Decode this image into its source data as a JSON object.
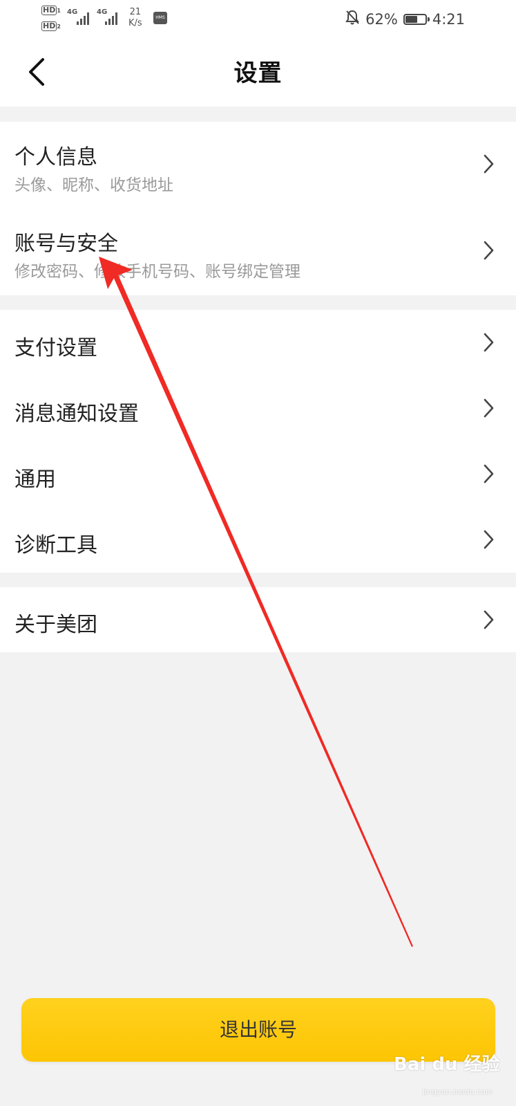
{
  "status_bar": {
    "hd1": "HD",
    "hd1_sub": "1",
    "hd2": "HD",
    "hd2_sub": "2",
    "net1": "4G",
    "net2": "4G",
    "speed_value": "21",
    "speed_unit": "K/s",
    "hms_badge": "HMS",
    "battery_percent": "62%",
    "battery_level": 0.62,
    "time": "4:21",
    "icons": [
      "signal-icon",
      "signal-icon",
      "hms-icon",
      "bell-off-icon",
      "battery-icon"
    ]
  },
  "header": {
    "title": "设置",
    "back_icon": "back-arrow-icon"
  },
  "settings": {
    "account_section": [
      {
        "title": "个人信息",
        "subtitle": "头像、昵称、收货地址"
      },
      {
        "title": "账号与安全",
        "subtitle": "修改密码、修改手机号码、账号绑定管理"
      }
    ],
    "general_section": [
      {
        "title": "支付设置"
      },
      {
        "title": "消息通知设置"
      },
      {
        "title": "通用"
      },
      {
        "title": "诊断工具"
      }
    ],
    "about_section": [
      {
        "title": "关于美团"
      }
    ]
  },
  "logout": {
    "label": "退出账号",
    "color": "#fdc504"
  },
  "annotation": {
    "arrow_color": "#f02a24"
  },
  "watermark": {
    "text": "Bai du 经验",
    "sub": "jingyan.baidu.com"
  }
}
